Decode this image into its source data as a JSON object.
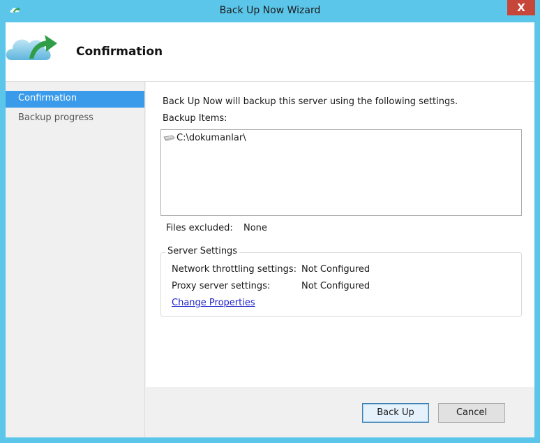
{
  "window": {
    "title": "Back Up Now Wizard",
    "close_label": "X"
  },
  "header": {
    "title": "Confirmation"
  },
  "nav": {
    "items": [
      {
        "label": "Confirmation",
        "selected": true
      },
      {
        "label": "Backup progress",
        "selected": false
      }
    ]
  },
  "main": {
    "intro": "Back Up Now will backup this server using the following settings.",
    "items_label": "Backup Items:",
    "items": [
      "C:\\dokumanlar\\"
    ],
    "files_excluded_label": "Files excluded:",
    "files_excluded_value": "None",
    "server_settings": {
      "title": "Server Settings",
      "network_label": "Network throttling settings:",
      "network_value": "Not Configured",
      "proxy_label": "Proxy server settings:",
      "proxy_value": "Not Configured",
      "change_link": "Change Properties"
    }
  },
  "buttons": {
    "backup_label": "Back Up",
    "cancel_label": "Cancel"
  },
  "colors": {
    "title_bar": "#5cc6ea",
    "selected_nav": "#3a9bea",
    "close_button": "#c7463a",
    "link": "#1a1fc8"
  }
}
